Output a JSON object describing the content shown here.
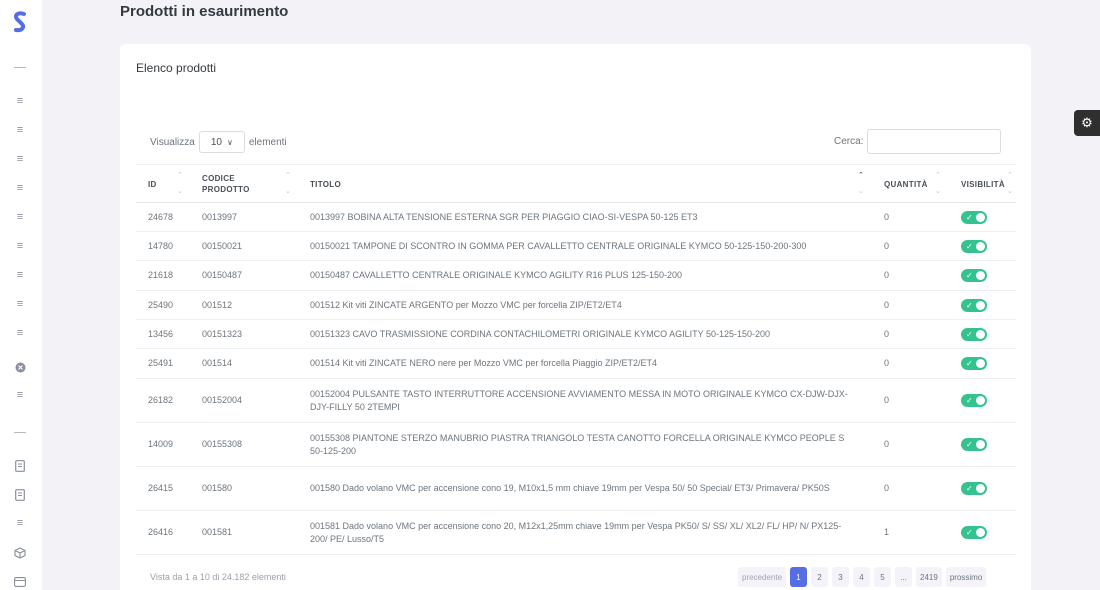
{
  "page": {
    "title": "Prodotti in esaurimento"
  },
  "card": {
    "title": "Elenco prodotti"
  },
  "controls": {
    "show_label": "Visualizza",
    "length_value": "10",
    "elements_label": "elementi",
    "search_label": "Cerca:",
    "search_value": ""
  },
  "table": {
    "headers": {
      "id": "ID",
      "codice_1": "CODICE",
      "codice_2": "PRODOTTO",
      "titolo": "TITOLO",
      "quantita": "QUANTITÀ",
      "visibilita": "VISIBILITÀ"
    },
    "rows": [
      {
        "id": "24678",
        "code": "0013997",
        "title": "0013997 BOBINA ALTA TENSIONE ESTERNA SGR PER PIAGGIO CIAO-SI-VESPA 50-125 ET3",
        "qty": "0",
        "visible": true
      },
      {
        "id": "14780",
        "code": "00150021",
        "title": "00150021 TAMPONE DI SCONTRO IN GOMMA PER CAVALLETTO CENTRALE ORIGINALE KYMCO 50-125-150-200-300",
        "qty": "0",
        "visible": true
      },
      {
        "id": "21618",
        "code": "00150487",
        "title": "00150487 CAVALLETTO CENTRALE ORIGINALE KYMCO AGILITY R16 PLUS 125-150-200",
        "qty": "0",
        "visible": true
      },
      {
        "id": "25490",
        "code": "001512",
        "title": "001512 Kit viti ZINCATE ARGENTO per Mozzo VMC per forcella ZIP/ET2/ET4",
        "qty": "0",
        "visible": true
      },
      {
        "id": "13456",
        "code": "00151323",
        "title": "00151323 CAVO TRASMISSIONE CORDINA CONTACHILOMETRI ORIGINALE KYMCO AGILITY 50-125-150-200",
        "qty": "0",
        "visible": true
      },
      {
        "id": "25491",
        "code": "001514",
        "title": "001514 Kit viti ZINCATE NERO nere per Mozzo VMC per forcella Piaggio ZIP/ET2/ET4",
        "qty": "0",
        "visible": true
      },
      {
        "id": "26182",
        "code": "00152004",
        "title": "00152004 PULSANTE TASTO INTERRUTTORE ACCENSIONE AVVIAMENTO MESSA IN MOTO ORIGINALE KYMCO CX-DJW-DJX-DJY-FILLY 50 2TEMPI",
        "qty": "0",
        "visible": true
      },
      {
        "id": "14009",
        "code": "00155308",
        "title": "00155308 PIANTONE STERZO MANUBRIO PIASTRA TRIANGOLO TESTA CANOTTO FORCELLA ORIGINALE KYMCO PEOPLE S 50-125-200",
        "qty": "0",
        "visible": true
      },
      {
        "id": "26415",
        "code": "001580",
        "title": "001580 Dado volano VMC per accensione cono 19, M10x1,5 mm chiave 19mm per Vespa 50/ 50 Special/ ET3/ Primavera/ PK50S",
        "qty": "0",
        "visible": true
      },
      {
        "id": "26416",
        "code": "001581",
        "title": "001581 Dado volano VMC per accensione cono 20, M12x1,25mm chiave 19mm per Vespa PK50/ S/ SS/ XL/ XL2/ FL/ HP/ N/ PX125-200/ PE/ Lusso/T5",
        "qty": "1",
        "visible": true
      }
    ]
  },
  "footer": {
    "info": "Vista da 1 a 10 di 24.182 elementi",
    "pagination": [
      "precedente",
      "1",
      "2",
      "3",
      "4",
      "5",
      "...",
      "2419",
      "prossimo"
    ],
    "active_page": "1"
  },
  "colors": {
    "accent": "#556ee6",
    "toggle_on": "#34c38f",
    "background": "#f2f2f7"
  },
  "icons": {
    "logo": "brand-s-logo",
    "settings": "gear-icon",
    "sidebar": "list-icon"
  }
}
